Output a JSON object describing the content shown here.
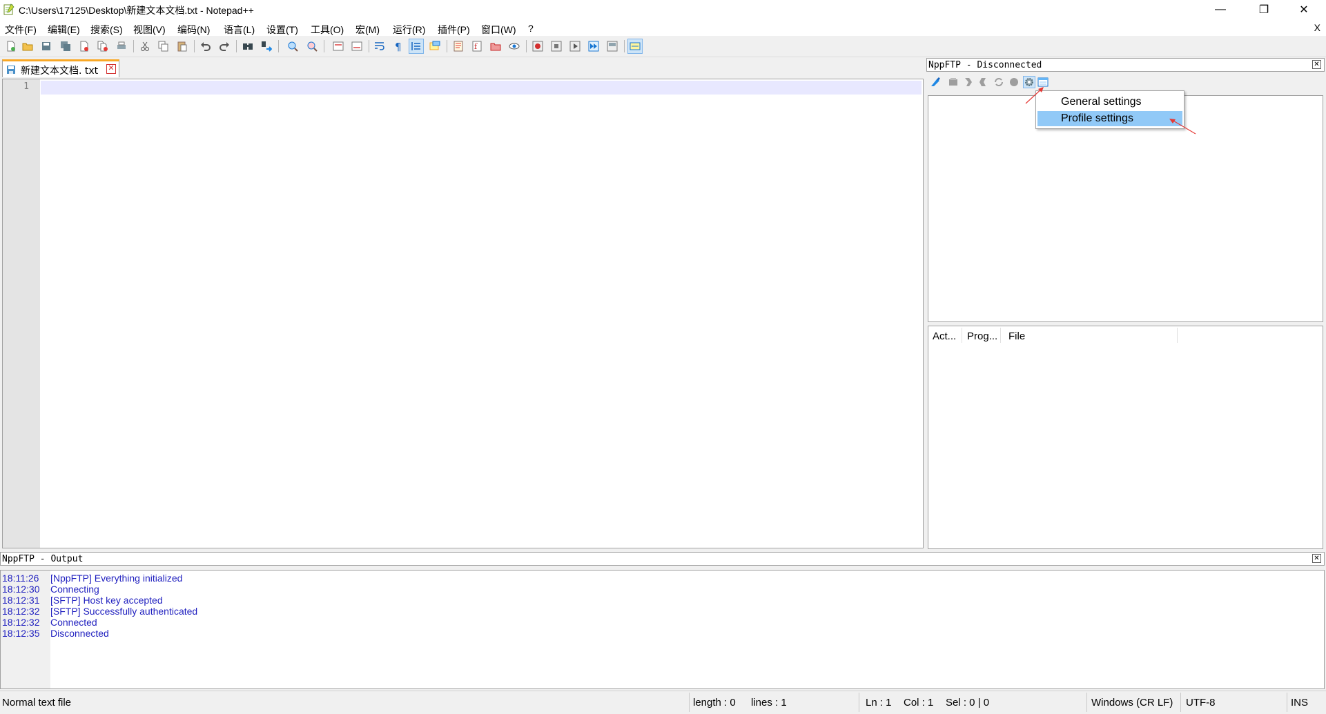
{
  "window": {
    "title": "C:\\Users\\17125\\Desktop\\新建文本文档.txt - Notepad++",
    "minimize_glyph": "—",
    "maximize_glyph": "❐",
    "close_glyph": "✕"
  },
  "menu": {
    "items": [
      "文件(F)",
      "编辑(E)",
      "搜索(S)",
      "视图(V)",
      "编码(N)",
      "语言(L)",
      "设置(T)",
      "工具(O)",
      "宏(M)",
      "运行(R)",
      "插件(P)",
      "窗口(W)",
      "?"
    ],
    "close_doc": "X"
  },
  "toolbar": {
    "icons": [
      "new-file-icon",
      "open-file-icon",
      "save-icon",
      "save-all-icon",
      "close-icon",
      "close-all-icon",
      "print-icon",
      "cut-icon",
      "copy-icon",
      "paste-icon",
      "undo-icon",
      "redo-icon",
      "find-icon",
      "replace-icon",
      "zoom-in-icon",
      "zoom-out-icon",
      "sync-vertical-icon",
      "sync-horizontal-icon",
      "word-wrap-icon",
      "show-all-chars-icon",
      "indent-guide-icon",
      "user-language-icon",
      "doc-map-icon",
      "function-list-icon",
      "folder-workspace-icon",
      "monitoring-icon",
      "record-macro-icon",
      "stop-record-icon",
      "play-macro-icon",
      "run-macro-multiple-icon",
      "save-macro-icon",
      "nppftp-icon"
    ]
  },
  "tab": {
    "label": "新建文本文档. txt",
    "close_glyph": "✕"
  },
  "editor": {
    "line_number": "1"
  },
  "ftp_panel": {
    "title": "NppFTP - Disconnected",
    "close_glyph": "✕",
    "icons": [
      "connect-icon",
      "disconnect-icon",
      "download-icon",
      "upload-icon",
      "refresh-icon",
      "abort-icon",
      "settings-icon",
      "message-window-icon"
    ],
    "dropdown": [
      "General settings",
      "Profile settings"
    ],
    "queue_columns": [
      "Act...",
      "Prog...",
      "File"
    ]
  },
  "output_panel": {
    "title": "NppFTP - Output",
    "close_glyph": "✕",
    "log": [
      {
        "time": "18:11:26",
        "msg": "[NppFTP] Everything initialized"
      },
      {
        "time": "18:12:30",
        "msg": "Connecting"
      },
      {
        "time": "18:12:31",
        "msg": "[SFTP] Host key accepted"
      },
      {
        "time": "18:12:32",
        "msg": "[SFTP] Successfully authenticated"
      },
      {
        "time": "18:12:32",
        "msg": "Connected"
      },
      {
        "time": "18:12:35",
        "msg": "Disconnected"
      }
    ]
  },
  "status": {
    "file_type": "Normal text file",
    "length": "length : 0",
    "lines": "lines : 1",
    "ln": "Ln : 1",
    "col": "Col : 1",
    "sel": "Sel : 0 | 0",
    "eol": "Windows (CR LF)",
    "encoding": "UTF-8",
    "mode": "INS"
  },
  "colors": {
    "log_text": "#1f1fbf",
    "selection": "#91c9f7",
    "current_line": "#e8e8ff",
    "tab_accent": "#f9a825",
    "annotation_arrow": "#e53935"
  }
}
